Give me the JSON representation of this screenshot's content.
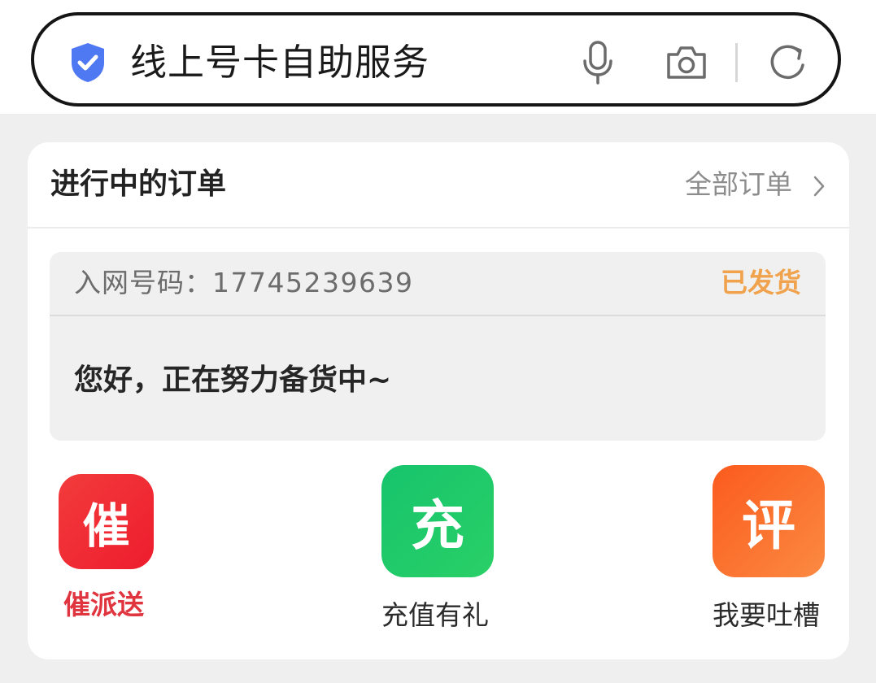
{
  "search": {
    "query": "线上号卡自助服务"
  },
  "icons": {
    "shield": "shield-check-icon",
    "mic": "microphone-icon",
    "camera": "camera-icon",
    "refresh": "refresh-icon"
  },
  "orders_card": {
    "title": "进行中的订单",
    "all_orders_label": "全部订单",
    "order": {
      "number_label": "入网号码：",
      "number_value": "17745239639",
      "status": "已发货",
      "message": "您好，正在努力备货中~"
    },
    "actions": [
      {
        "icon_char": "催",
        "label": "催派送"
      },
      {
        "icon_char": "充",
        "label": "充值有礼"
      },
      {
        "icon_char": "评",
        "label": "我要吐槽"
      }
    ]
  },
  "colors": {
    "background": "#efefef",
    "status_orange": "#f0a24d",
    "urge_red": "#ee1d2e",
    "recharge_green": "#1fc86a",
    "review_orange": "#fb6a2a",
    "shield_blue": "#4f78f3"
  }
}
